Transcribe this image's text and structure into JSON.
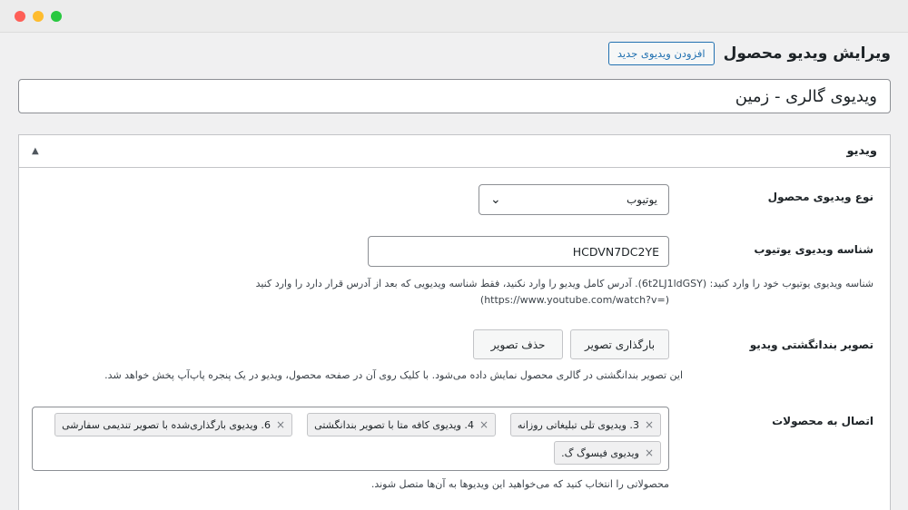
{
  "page": {
    "title": "ویرایش ویدیو محصول",
    "add_new_label": "افزودن ویدیوی جدید",
    "video_title_value": "ویدیوی گالری - زمین"
  },
  "metabox": {
    "title": "ویدیو",
    "collapse_icon": "triangle-up-icon"
  },
  "fields": {
    "video_type": {
      "label": "نوع ویدیوی محصول",
      "selected": "یوتیوب"
    },
    "youtube_id": {
      "label": "شناسه ویدیوی یوتیوب",
      "value": "HCDVN7DC2YE",
      "desc_line1": "شناسه ویدیوی یوتیوب خود را وارد کنید: (6t2LJ1ldGSY). آدرس کامل ویدیو را وارد نکنید، فقط شناسه ویدیویی که بعد از آدرس قرار دارد را وارد کنید",
      "desc_line2": "(https://www.youtube.com/watch?v=)"
    },
    "thumbnail": {
      "label": "تصویر بندانگشتی ویدیو",
      "upload_label": "بارگذاری تصویر",
      "remove_label": "حذف تصویر",
      "desc": "این تصویر بندانگشتی در گالری محصول نمایش داده می‌شود. با کلیک روی آن در صفحه محصول، ویدیو در یک پنجره پاپ‌آپ پخش خواهد شد."
    },
    "products": {
      "label": "اتصال به محصولات",
      "tags": [
        "3. ویدیوی تلی تبلیغاتی روزانه",
        "4. ویدیوی کافه متا با تصویر بندانگشتی",
        "6. ویدیوی بارگذاری‌شده با تصویر تندیمی سفارشی",
        "ویدیوی فیسوگ گ."
      ],
      "tag_remove_glyph": "×",
      "desc": "محصولاتی را انتخاب کنید که می‌خواهید این ویدیوها به آن‌ها متصل شوند."
    }
  }
}
